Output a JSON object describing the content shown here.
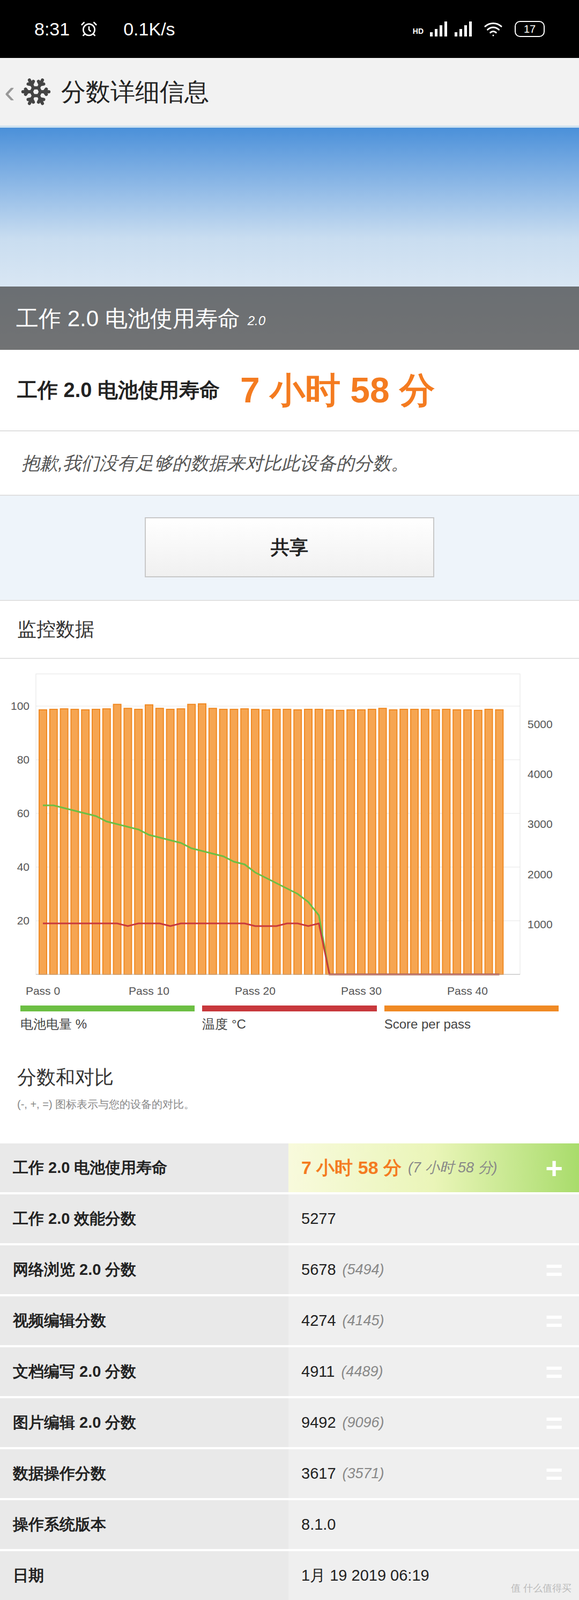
{
  "status_bar": {
    "time": "8:31",
    "speed": "0.1K/s",
    "network": "HD",
    "battery": "17"
  },
  "header": {
    "back": "‹",
    "title": "分数详细信息"
  },
  "hero": {
    "title": "工作 2.0 电池使用寿命",
    "version": "2.0"
  },
  "result": {
    "label": "工作 2.0 电池使用寿命",
    "value": "7 小时 58 分"
  },
  "notice": "抱歉,我们没有足够的数据来对比此设备的分数。",
  "share_button": "共享",
  "monitor": {
    "title": "监控数据",
    "left_ticks": [
      "100",
      "80",
      "60",
      "40",
      "20"
    ],
    "right_ticks": [
      "5000",
      "4000",
      "3000",
      "2000",
      "1000"
    ],
    "x_ticks": [
      "Pass 0",
      "Pass 10",
      "Pass 20",
      "Pass 30",
      "Pass 40"
    ],
    "series": [
      {
        "name": "电池电量 %",
        "color": "#6cbf43",
        "axis": "left",
        "values": [
          63,
          63,
          62,
          61,
          60,
          59,
          57,
          56,
          55,
          54,
          52,
          51,
          50,
          49,
          47,
          46,
          45,
          44,
          42,
          41,
          38,
          36,
          34,
          32,
          30,
          27,
          22,
          0,
          0,
          0,
          0,
          0,
          0,
          0,
          0,
          0,
          0,
          0,
          0,
          0,
          0,
          0,
          0,
          0
        ]
      },
      {
        "name": "温度 °C",
        "color": "#c8383c",
        "axis": "left",
        "values": [
          19,
          19,
          19,
          19,
          19,
          19,
          19,
          19,
          18,
          19,
          19,
          19,
          18,
          19,
          19,
          19,
          19,
          19,
          19,
          19,
          18,
          18,
          18,
          19,
          19,
          18,
          19,
          0,
          0,
          0,
          0,
          0,
          0,
          0,
          0,
          0,
          0,
          0,
          0,
          0,
          0,
          0,
          0,
          0
        ]
      },
      {
        "name": "Score per pass",
        "color": "#f08a24",
        "axis": "right",
        "values": [
          5290,
          5300,
          5310,
          5300,
          5290,
          5300,
          5310,
          5400,
          5320,
          5300,
          5390,
          5320,
          5300,
          5310,
          5400,
          5410,
          5320,
          5300,
          5300,
          5310,
          5300,
          5290,
          5300,
          5300,
          5290,
          5300,
          5300,
          5290,
          5280,
          5290,
          5290,
          5300,
          5320,
          5290,
          5300,
          5300,
          5300,
          5290,
          5300,
          5290,
          5290,
          5280,
          5300,
          5290
        ]
      }
    ]
  },
  "comparison": {
    "title": "分数和对比",
    "subtitle": "(-, +, =) 图标表示与您的设备的对比。",
    "rows": [
      {
        "label": "工作 2.0 电池使用寿命",
        "value": "7 小时 58 分",
        "compare": "(7 小时 58 分)",
        "sign": "+",
        "highlight": true
      },
      {
        "label": "工作 2.0 效能分数",
        "value": "5277",
        "compare": "",
        "sign": "",
        "highlight": false
      },
      {
        "label": "网络浏览 2.0 分数",
        "value": "5678",
        "compare": "(5494)",
        "sign": "=",
        "highlight": false
      },
      {
        "label": "视频编辑分数",
        "value": "4274",
        "compare": "(4145)",
        "sign": "=",
        "highlight": false
      },
      {
        "label": "文档编写 2.0 分数",
        "value": "4911",
        "compare": "(4489)",
        "sign": "=",
        "highlight": false
      },
      {
        "label": "图片编辑 2.0 分数",
        "value": "9492",
        "compare": "(9096)",
        "sign": "=",
        "highlight": false
      },
      {
        "label": "数据操作分数",
        "value": "3617",
        "compare": "(3571)",
        "sign": "=",
        "highlight": false
      },
      {
        "label": "操作系统版本",
        "value": "8.1.0",
        "compare": "",
        "sign": "",
        "highlight": false
      },
      {
        "label": "日期",
        "value": "1月 19 2019 06:19",
        "compare": "",
        "sign": "",
        "highlight": false
      }
    ]
  },
  "watermark": "值 什么值得买"
}
